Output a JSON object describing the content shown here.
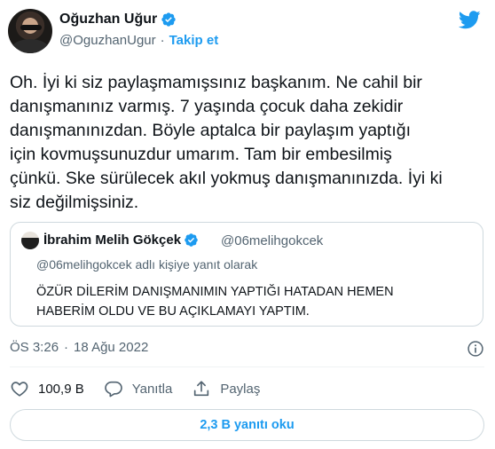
{
  "author": {
    "name": "Oğuzhan Uğur",
    "handle": "@OguzhanUgur",
    "separator": "·",
    "follow_label": "Takip et",
    "avatar_icon": "user-avatar"
  },
  "brand": {
    "icon": "twitter-bird-icon",
    "color": "#1d9bf0"
  },
  "tweet": {
    "text": "Oh. İyi ki siz paylaşmamışsınız başkanım. Ne cahil bir\ndanışmanınız varmış. 7 yaşında çocuk daha zekidir\ndanışmanınızdan. Böyle aptalca bir paylaşım yaptığı\niçin kovmuşsunuzdur umarım. Tam bir embesilmiş\nçünkü. Ske sürülecek akıl yokmuş danışmanınızda. İyi ki\nsiz değilmişsiniz."
  },
  "quoted": {
    "name": "İbrahim Melih Gökçek",
    "handle": "@06melihgokcek",
    "reply_context": "@06melihgokcek adlı kişiye yanıt olarak",
    "text": "ÖZÜR DİLERİM DANIŞMANIMIN YAPTIĞI HATADAN HEMEN\nHABERİM OLDU VE BU AÇIKLAMAYI YAPTIM."
  },
  "meta": {
    "time": "ÖS 3:26",
    "separator": "·",
    "date": "18 Ağu 2022"
  },
  "actions": {
    "like_count": "100,9 B",
    "reply_label": "Yanıtla",
    "share_label": "Paylaş"
  },
  "replies_button": "2,3 B yanıtı oku",
  "colors": {
    "accent": "#1d9bf0",
    "text": "#0f1419",
    "muted": "#536471",
    "border": "#cfd9de"
  }
}
